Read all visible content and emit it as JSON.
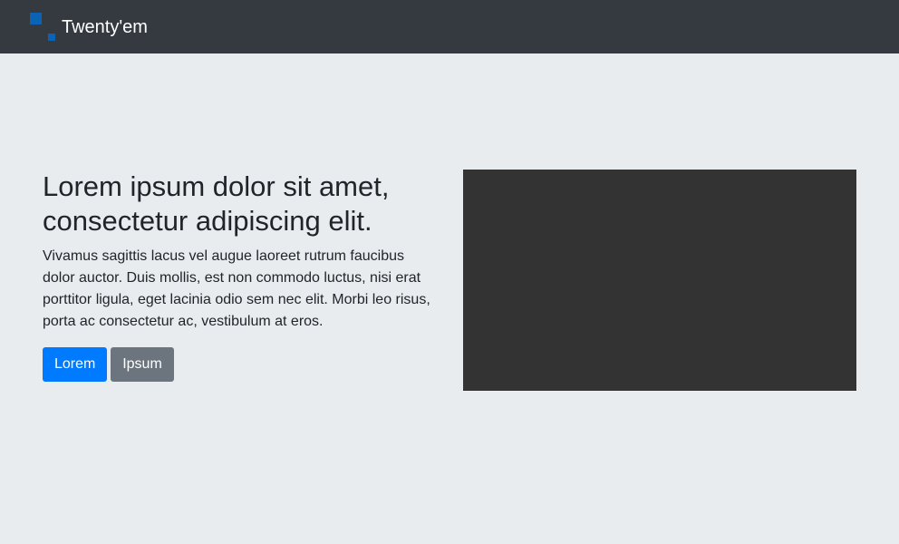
{
  "navbar": {
    "brand_name": "Twenty'em",
    "logo_icon": "twentyem-logo-icon",
    "background": "#343a40",
    "logo_color": "#0b63b6"
  },
  "hero": {
    "heading": "Lorem ipsum dolor sit amet, consectetur adipiscing elit.",
    "paragraph": "Vivamus sagittis lacus vel augue laoreet rutrum faucibus dolor auctor. Duis mollis, est non commodo luctus, nisi erat porttitor ligula, eget lacinia odio sem nec elit. Morbi leo risus, porta ac consectetur ac, vestibulum at eros.",
    "buttons": {
      "primary_label": "Lorem",
      "secondary_label": "Ipsum"
    }
  },
  "colors": {
    "page_background": "#e9ecef",
    "text": "#212529",
    "primary_button": "#007bff",
    "secondary_button": "#6c757d",
    "media_placeholder": "#333333"
  }
}
